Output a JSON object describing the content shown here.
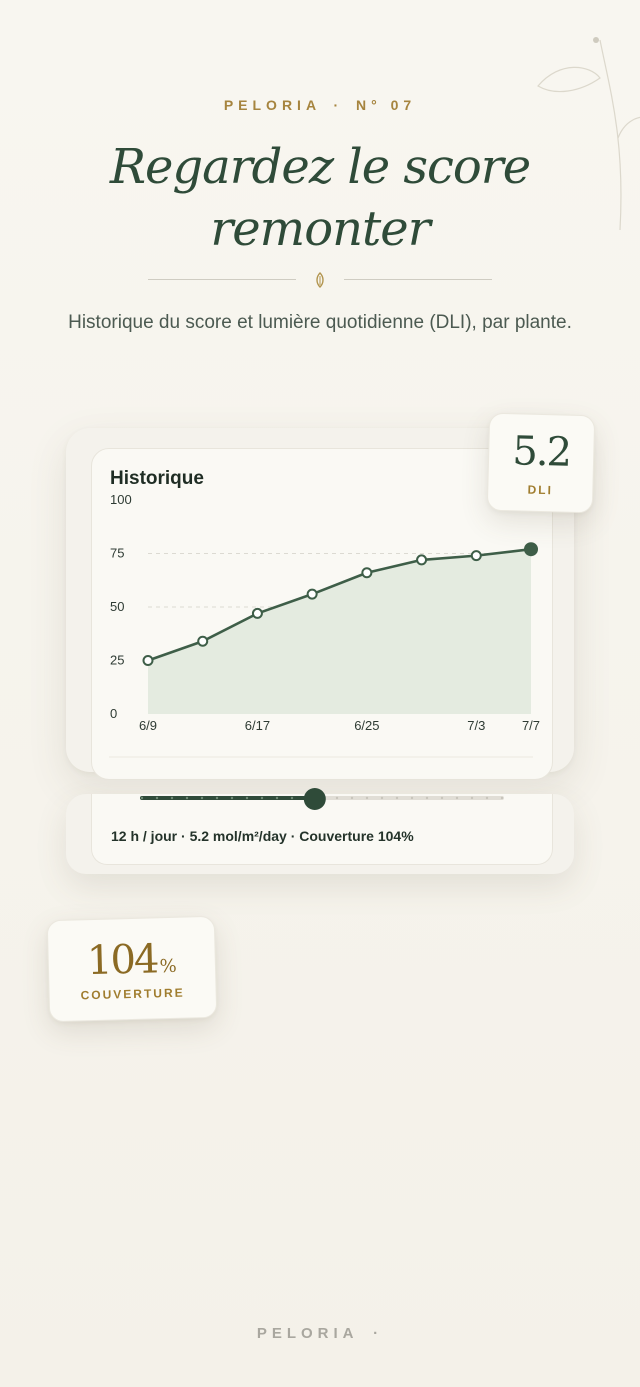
{
  "header": {
    "brand": "PELORIA",
    "issue": "N° 07",
    "separator": "·",
    "headline_line1": "Regardez le score",
    "headline_line2": "remonter",
    "subtitle": "Historique du score et lumière quotidienne (DLI), par plante."
  },
  "chart_card": {
    "title": "Historique"
  },
  "chart_data": {
    "type": "area",
    "title": "Historique",
    "xlabel": "",
    "ylabel": "",
    "ylim": [
      0,
      100
    ],
    "yticks": [
      0,
      25,
      50,
      75,
      100
    ],
    "x_tick_labels": [
      "6/9",
      "6/17",
      "6/25",
      "7/3",
      "7/7"
    ],
    "grid": "horizontal dashed",
    "series": [
      {
        "values": [
          25,
          34,
          47,
          56,
          66,
          72,
          74,
          77
        ],
        "color": "#3e5e48"
      }
    ],
    "fill_color": "#e4ebe0",
    "last_point_highlighted": true
  },
  "light_panel": {
    "info": "12 h / jour · 5.2 mol/m²/day · Couverture 104%",
    "slider_fraction": 0.48
  },
  "stats": {
    "dli": {
      "value": "5.2",
      "label": "DLI"
    },
    "coverage": {
      "value": "104",
      "unit": "%",
      "label": "COUVERTURE"
    }
  },
  "footer": {
    "brand": "PELORIA",
    "dot": "·"
  },
  "colors": {
    "accent_gold": "#a6843e",
    "forest": "#2f4b39",
    "line": "#3e5e48",
    "background": "#f6f3ec"
  }
}
